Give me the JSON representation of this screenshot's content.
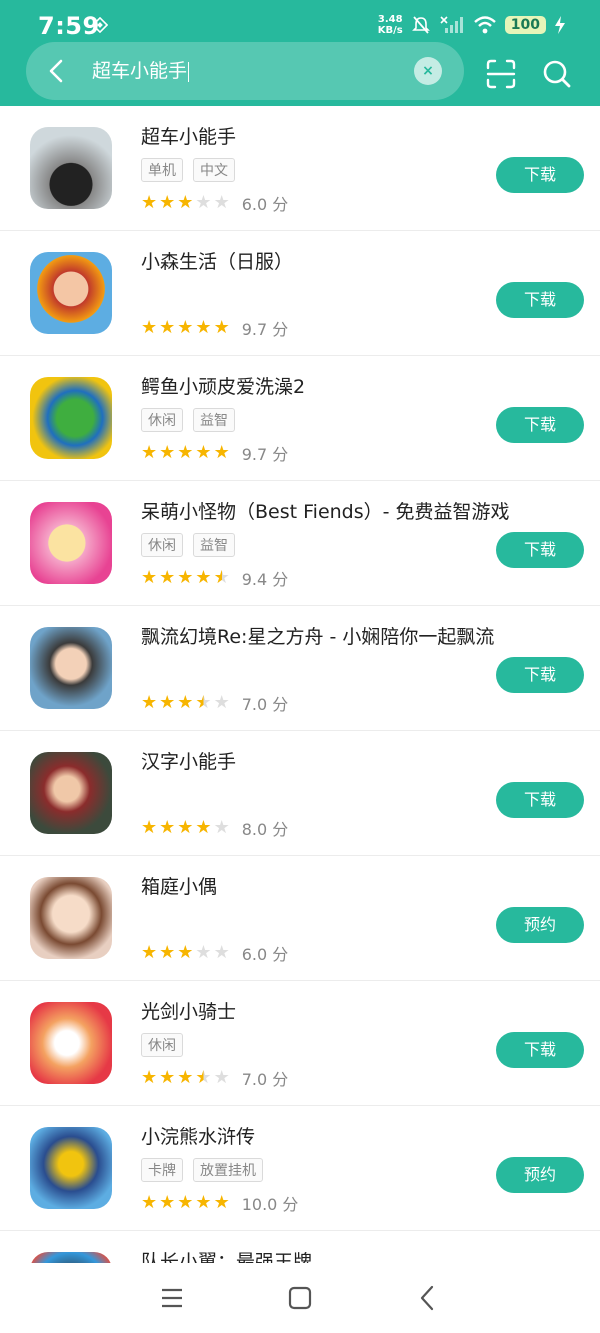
{
  "status": {
    "time": "7:59",
    "net_speed_value": "3.48",
    "net_speed_unit": "KB/s",
    "battery": "100"
  },
  "search": {
    "query": "超车小能手",
    "clear_label": "×"
  },
  "apps": [
    {
      "name": "超车小能手",
      "tags": [
        "单机",
        "中文"
      ],
      "rating": 6.0,
      "score_label": "6.0 分",
      "action": "下载"
    },
    {
      "name": "小森生活（日服）",
      "tags": [],
      "rating": 9.7,
      "score_label": "9.7 分",
      "action": "下载"
    },
    {
      "name": "鳄鱼小顽皮爱洗澡2",
      "tags": [
        "休闲",
        "益智"
      ],
      "rating": 9.7,
      "score_label": "9.7 分",
      "action": "下载"
    },
    {
      "name": "呆萌小怪物（Best Fiends）- 免费益智游戏",
      "tags": [
        "休闲",
        "益智"
      ],
      "rating": 9.4,
      "score_label": "9.4 分",
      "action": "下载"
    },
    {
      "name": "飘流幻境Re:星之方舟 - 小娴陪你一起飘流",
      "tags": [],
      "rating": 7.0,
      "score_label": "7.0 分",
      "action": "下载"
    },
    {
      "name": "汉字小能手",
      "tags": [],
      "rating": 8.0,
      "score_label": "8.0 分",
      "action": "下载"
    },
    {
      "name": "箱庭小偶",
      "tags": [],
      "rating": 6.0,
      "score_label": "6.0 分",
      "action": "预约"
    },
    {
      "name": "光剑小骑士",
      "tags": [
        "休闲"
      ],
      "rating": 7.0,
      "score_label": "7.0 分",
      "action": "下载"
    },
    {
      "name": "小浣熊水浒传",
      "tags": [
        "卡牌",
        "放置挂机"
      ],
      "rating": 10.0,
      "score_label": "10.0 分",
      "action": "预约"
    },
    {
      "name": "队长小翼：最强王牌",
      "tags": [],
      "rating": null,
      "score_label": "",
      "action": ""
    }
  ],
  "colors": {
    "accent": "#27b99d",
    "star": "#f7b500",
    "star_empty": "#dedede"
  }
}
